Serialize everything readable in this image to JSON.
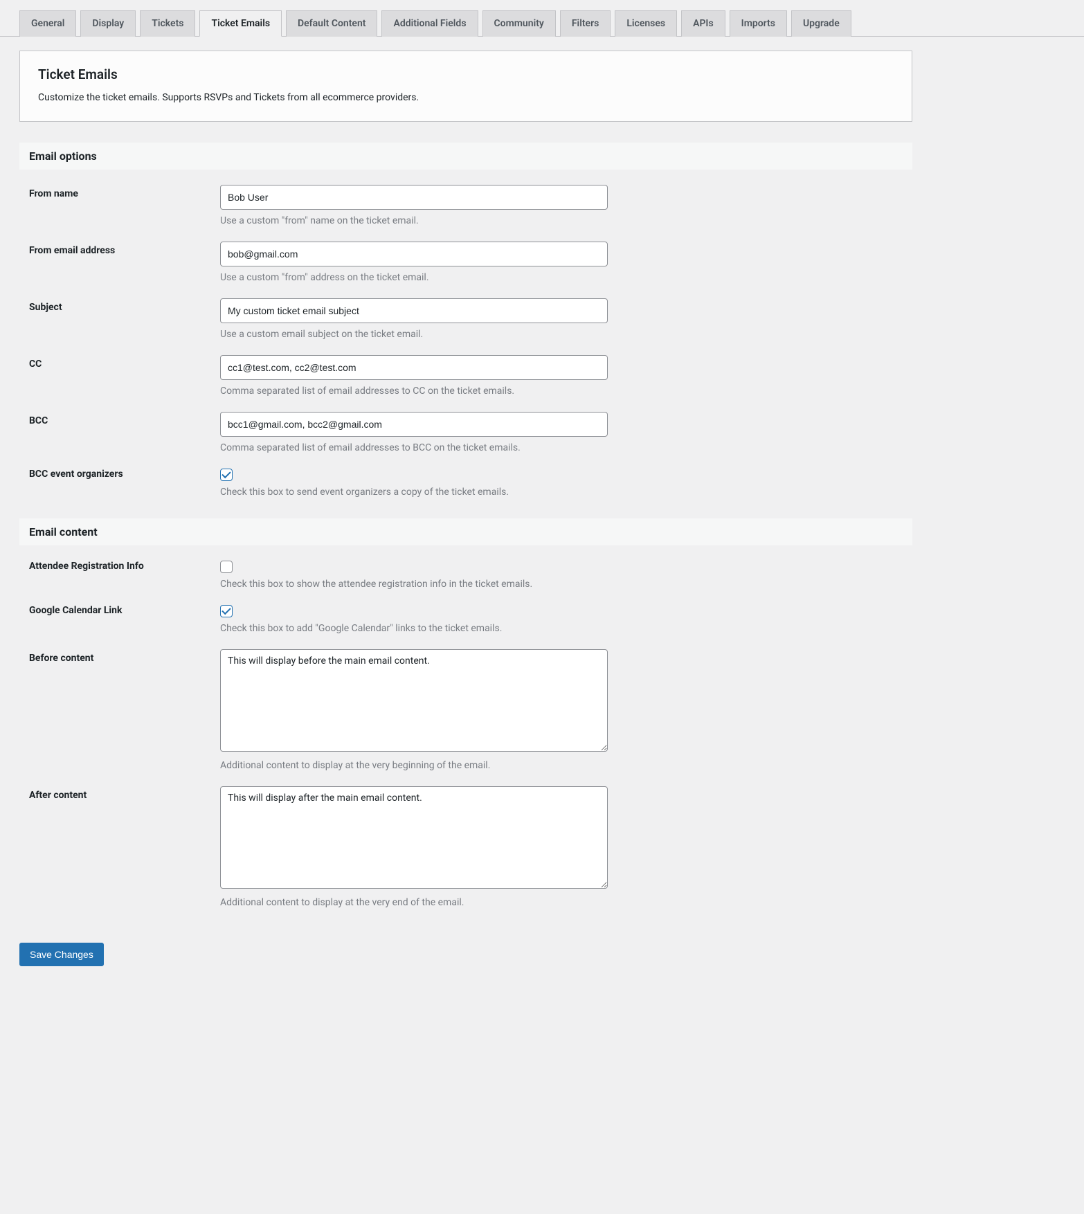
{
  "tabs": [
    {
      "label": "General"
    },
    {
      "label": "Display"
    },
    {
      "label": "Tickets"
    },
    {
      "label": "Ticket Emails"
    },
    {
      "label": "Default Content"
    },
    {
      "label": "Additional Fields"
    },
    {
      "label": "Community"
    },
    {
      "label": "Filters"
    },
    {
      "label": "Licenses"
    },
    {
      "label": "APIs"
    },
    {
      "label": "Imports"
    },
    {
      "label": "Upgrade"
    }
  ],
  "active_tab_index": 3,
  "panel": {
    "title": "Ticket Emails",
    "description": "Customize the ticket emails. Supports RSVPs and Tickets from all ecommerce providers."
  },
  "sections": {
    "options_heading": "Email options",
    "content_heading": "Email content"
  },
  "fields": {
    "from_name": {
      "label": "From name",
      "value": "Bob User",
      "desc": "Use a custom \"from\" name on the ticket email."
    },
    "from_email": {
      "label": "From email address",
      "value": "bob@gmail.com",
      "desc": "Use a custom \"from\" address on the ticket email."
    },
    "subject": {
      "label": "Subject",
      "value": "My custom ticket email subject",
      "desc": "Use a custom email subject on the ticket email."
    },
    "cc": {
      "label": "CC",
      "value": "cc1@test.com, cc2@test.com",
      "desc": "Comma separated list of email addresses to CC on the ticket emails."
    },
    "bcc": {
      "label": "BCC",
      "value": "bcc1@gmail.com, bcc2@gmail.com",
      "desc": "Comma separated list of email addresses to BCC on the ticket emails."
    },
    "bcc_organizers": {
      "label": "BCC event organizers",
      "checked": true,
      "desc": "Check this box to send event organizers a copy of the ticket emails."
    },
    "attendee_info": {
      "label": "Attendee Registration Info",
      "checked": false,
      "desc": "Check this box to show the attendee registration info in the ticket emails."
    },
    "gcal_link": {
      "label": "Google Calendar Link",
      "checked": true,
      "desc": "Check this box to add \"Google Calendar\" links to the ticket emails."
    },
    "before_content": {
      "label": "Before content",
      "value": "This will display before the main email content.",
      "desc": "Additional content to display at the very beginning of the email."
    },
    "after_content": {
      "label": "After content",
      "value": "This will display after the main email content.",
      "desc": "Additional content to display at the very end of the email."
    }
  },
  "save_button": "Save Changes"
}
